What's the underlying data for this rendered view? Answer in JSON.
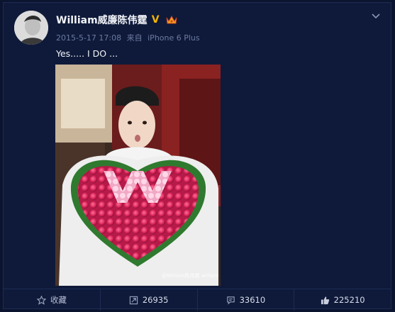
{
  "post": {
    "author": "William威廉陈伟霆",
    "timestamp": "2015-5-17 17:08",
    "source_prefix": "来自",
    "source": "iPhone 6 Plus",
    "text": "Yes..... I DO ...",
    "watermark": "@William陈伟霆 william chan"
  },
  "actions": {
    "favorite_label": "收藏",
    "repost_count": "26935",
    "comment_count": "33610",
    "like_count": "225210"
  },
  "icons": [
    "verified-v-icon",
    "crown-icon",
    "chevron-down-icon",
    "star-icon",
    "repost-icon",
    "comment-icon",
    "thumbs-up-icon"
  ],
  "colors": {
    "background": "#0b1530",
    "card": "#0f1a3a",
    "verified": "#f5b400",
    "roses": "#e0336a"
  }
}
